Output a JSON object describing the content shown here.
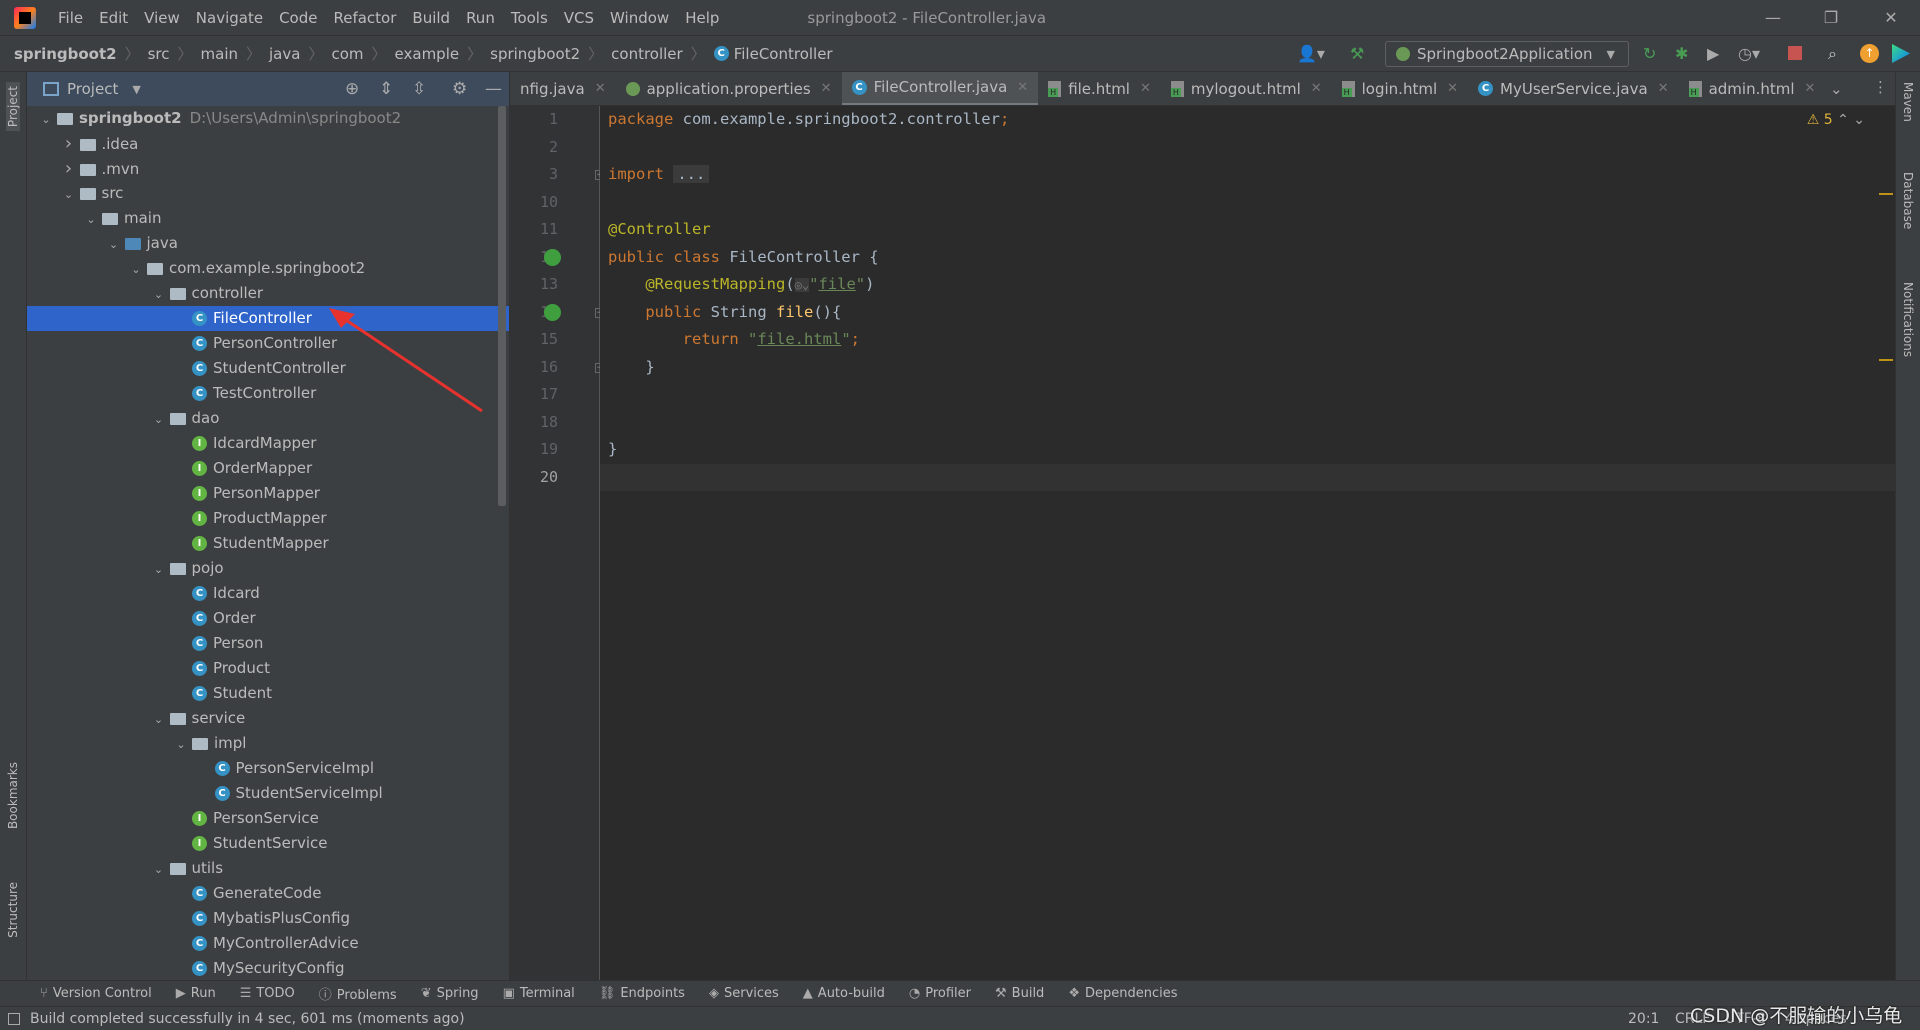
{
  "window": {
    "title": "springboot2 - FileController.java",
    "menu": [
      "File",
      "Edit",
      "View",
      "Navigate",
      "Code",
      "Refactor",
      "Build",
      "Run",
      "Tools",
      "VCS",
      "Window",
      "Help"
    ]
  },
  "breadcrumb": [
    "springboot2",
    "src",
    "main",
    "java",
    "com",
    "example",
    "springboot2",
    "controller",
    "FileController"
  ],
  "toolbar": {
    "run_config": "Springboot2Application"
  },
  "left_strip": [
    "Project",
    "Bookmarks",
    "Structure"
  ],
  "right_strip": [
    "Maven",
    "Database",
    "Notifications"
  ],
  "project": {
    "title": "Project",
    "tree": [
      {
        "label": "springboot2",
        "path": "D:\\Users\\Admin\\springboot2",
        "depth": 0,
        "type": "module",
        "arrow": "down",
        "bold": true
      },
      {
        "label": ".idea",
        "depth": 1,
        "type": "folder",
        "arrow": "right"
      },
      {
        "label": ".mvn",
        "depth": 1,
        "type": "folder",
        "arrow": "right"
      },
      {
        "label": "src",
        "depth": 1,
        "type": "folder",
        "arrow": "down"
      },
      {
        "label": "main",
        "depth": 2,
        "type": "folder",
        "arrow": "down"
      },
      {
        "label": "java",
        "depth": 3,
        "type": "folder-blue",
        "arrow": "down"
      },
      {
        "label": "com.example.springboot2",
        "depth": 4,
        "type": "package",
        "arrow": "down"
      },
      {
        "label": "controller",
        "depth": 5,
        "type": "package",
        "arrow": "down"
      },
      {
        "label": "FileController",
        "depth": 6,
        "type": "class",
        "selected": true
      },
      {
        "label": "PersonController",
        "depth": 6,
        "type": "class"
      },
      {
        "label": "StudentController",
        "depth": 6,
        "type": "class"
      },
      {
        "label": "TestController",
        "depth": 6,
        "type": "class"
      },
      {
        "label": "dao",
        "depth": 5,
        "type": "package",
        "arrow": "down"
      },
      {
        "label": "IdcardMapper",
        "depth": 6,
        "type": "interface"
      },
      {
        "label": "OrderMapper",
        "depth": 6,
        "type": "interface"
      },
      {
        "label": "PersonMapper",
        "depth": 6,
        "type": "interface"
      },
      {
        "label": "ProductMapper",
        "depth": 6,
        "type": "interface"
      },
      {
        "label": "StudentMapper",
        "depth": 6,
        "type": "interface"
      },
      {
        "label": "pojo",
        "depth": 5,
        "type": "package",
        "arrow": "down"
      },
      {
        "label": "Idcard",
        "depth": 6,
        "type": "class"
      },
      {
        "label": "Order",
        "depth": 6,
        "type": "class"
      },
      {
        "label": "Person",
        "depth": 6,
        "type": "class"
      },
      {
        "label": "Product",
        "depth": 6,
        "type": "class"
      },
      {
        "label": "Student",
        "depth": 6,
        "type": "class"
      },
      {
        "label": "service",
        "depth": 5,
        "type": "package",
        "arrow": "down"
      },
      {
        "label": "impl",
        "depth": 6,
        "type": "package",
        "arrow": "down"
      },
      {
        "label": "PersonServiceImpl",
        "depth": 7,
        "type": "class"
      },
      {
        "label": "StudentServiceImpl",
        "depth": 7,
        "type": "class"
      },
      {
        "label": "PersonService",
        "depth": 6,
        "type": "interface"
      },
      {
        "label": "StudentService",
        "depth": 6,
        "type": "interface"
      },
      {
        "label": "utils",
        "depth": 5,
        "type": "package",
        "arrow": "down"
      },
      {
        "label": "GenerateCode",
        "depth": 6,
        "type": "class"
      },
      {
        "label": "MybatisPlusConfig",
        "depth": 6,
        "type": "class"
      },
      {
        "label": "MyControllerAdvice",
        "depth": 6,
        "type": "class"
      },
      {
        "label": "MySecurityConfig",
        "depth": 6,
        "type": "class"
      }
    ]
  },
  "tabs": [
    {
      "label": "nfig.java",
      "icon": "none"
    },
    {
      "label": "application.properties",
      "icon": "properties"
    },
    {
      "label": "FileController.java",
      "icon": "class",
      "active": true
    },
    {
      "label": "file.html",
      "icon": "html"
    },
    {
      "label": "mylogout.html",
      "icon": "html"
    },
    {
      "label": "login.html",
      "icon": "html"
    },
    {
      "label": "MyUserService.java",
      "icon": "class"
    },
    {
      "label": "admin.html",
      "icon": "html"
    }
  ],
  "editor": {
    "warnings": "5",
    "lines": [
      {
        "n": "1",
        "tokens": [
          [
            "package ",
            "kw"
          ],
          [
            "com.example.springboot2.controller",
            ""
          ],
          [
            ";",
            "kw"
          ]
        ]
      },
      {
        "n": "2",
        "tokens": []
      },
      {
        "n": "3",
        "tokens": [
          [
            "import ",
            "kw"
          ],
          [
            "...",
            "fold"
          ]
        ],
        "fold": "+"
      },
      {
        "n": "10",
        "tokens": []
      },
      {
        "n": "11",
        "tokens": [
          [
            "@Controller",
            "ann"
          ]
        ]
      },
      {
        "n": "12",
        "tokens": [
          [
            "public class ",
            "kw"
          ],
          [
            "FileController {",
            ""
          ]
        ],
        "gicon": true
      },
      {
        "n": "13",
        "tokens": [
          [
            "    @RequestMapping",
            "ann"
          ],
          [
            "(",
            ""
          ],
          [
            "◎⌄",
            "hint"
          ],
          [
            "\"",
            "str"
          ],
          [
            "file",
            "strul"
          ],
          [
            "\"",
            "str"
          ],
          [
            ")",
            ""
          ]
        ]
      },
      {
        "n": "14",
        "tokens": [
          [
            "    public ",
            "kw"
          ],
          [
            "String ",
            ""
          ],
          [
            "file",
            "fn"
          ],
          [
            "(){",
            ""
          ]
        ],
        "gicon": true,
        "fold": "-"
      },
      {
        "n": "15",
        "tokens": [
          [
            "        return ",
            "kw"
          ],
          [
            "\"",
            "str"
          ],
          [
            "file.html",
            "strul"
          ],
          [
            "\"",
            "str"
          ],
          [
            ";",
            "kw"
          ]
        ]
      },
      {
        "n": "16",
        "tokens": [
          [
            "    }",
            ""
          ]
        ],
        "fold": "-"
      },
      {
        "n": "17",
        "tokens": []
      },
      {
        "n": "18",
        "tokens": []
      },
      {
        "n": "19",
        "tokens": [
          [
            "}",
            ""
          ]
        ]
      },
      {
        "n": "20",
        "tokens": [],
        "current": true
      }
    ]
  },
  "bottom_tools": [
    "Version Control",
    "Run",
    "TODO",
    "Problems",
    "Spring",
    "Terminal",
    "Endpoints",
    "Services",
    "Auto-build",
    "Profiler",
    "Build",
    "Dependencies"
  ],
  "status": {
    "message": "Build completed successfully in 4 sec, 601 ms (moments ago)",
    "position": "20:1",
    "line_sep": "CRLF",
    "encoding": "UTF-8",
    "indent": "4 spaces",
    "watermark": "CSDN @不服输的小乌龟"
  },
  "colors": {
    "keyword": "#cc7832",
    "annotation": "#bbb529",
    "string": "#6a8759",
    "text": "#a9b7c6",
    "method": "#ffc66d",
    "selection": "#2f65ca"
  }
}
